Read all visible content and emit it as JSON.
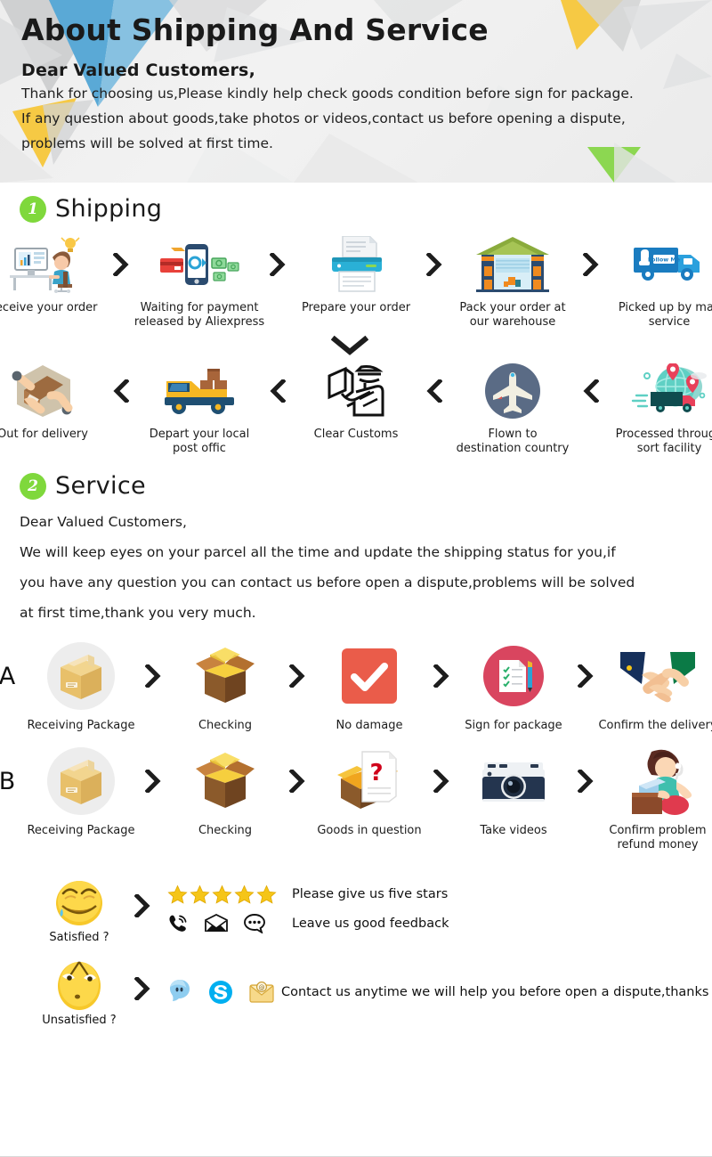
{
  "banner": {
    "title": "About Shipping And Service",
    "subtitle": "Dear Valued Customers,",
    "lines": [
      "Thank for choosing us,Please kindly help check goods condition before sign for package.",
      "If any question about goods,take photos or videos,contact us before opening a dispute,",
      "problems will be solved at first time."
    ]
  },
  "colors": {
    "accent_green": "#7fd83c",
    "banner_bg": "#eeeeee",
    "deco_blue": "#5aa9d6",
    "deco_yellow": "#f6c944",
    "deco_green": "#8cd751",
    "deco_grey": "#c9cacb",
    "star_yellow": "#f5c518",
    "red_check": "#ea5c4a",
    "pink_sign": "#d9455f"
  },
  "shipping": {
    "badge": "1",
    "title": "Shipping",
    "row1": [
      {
        "icon": "desk-person-icon",
        "label": "Receive your order"
      },
      {
        "icon": "phone-payment-icon",
        "label": "Waiting for payment\nreleased by Aliexpress"
      },
      {
        "icon": "printer-icon",
        "label": "Prepare your order"
      },
      {
        "icon": "warehouse-icon",
        "label": "Pack your order at\nour warehouse"
      },
      {
        "icon": "mail-truck-icon",
        "label": "Picked up by mail service"
      }
    ],
    "row1_separator": "chevron-right-icon",
    "turn_icon": "chevron-down-icon",
    "row2": [
      {
        "icon": "hands-package-icon",
        "label": "Out for delivery"
      },
      {
        "icon": "delivery-van-icon",
        "label": "Depart your local\npost offic"
      },
      {
        "icon": "customs-officer-icon",
        "label": "Clear Customs"
      },
      {
        "icon": "airplane-icon",
        "label": "Flown to\ndestination country"
      },
      {
        "icon": "globe-truck-icon",
        "label": "Processed through\nsort facility"
      }
    ],
    "row2_separator": "chevron-left-icon"
  },
  "service": {
    "badge": "2",
    "title": "Service",
    "greeting": "Dear Valued Customers,",
    "lines": [
      "We will keep eyes on your parcel all the time and update the shipping status for you,if",
      "you have any question you can contact us before open a dispute,problems will be solved",
      "at first time,thank you very much."
    ],
    "flow_a": {
      "letter": "A",
      "steps": [
        {
          "icon": "package-box-icon",
          "label": "Receiving Package"
        },
        {
          "icon": "open-box-icon",
          "label": "Checking"
        },
        {
          "icon": "red-check-icon",
          "label": "No damage"
        },
        {
          "icon": "sign-document-icon",
          "label": "Sign for package"
        },
        {
          "icon": "handshake-icon",
          "label": "Confirm the delivery"
        }
      ]
    },
    "flow_b": {
      "letter": "B",
      "steps": [
        {
          "icon": "package-box-icon",
          "label": "Receiving Package"
        },
        {
          "icon": "open-box-icon",
          "label": "Checking"
        },
        {
          "icon": "question-goods-icon",
          "label": "Goods in question"
        },
        {
          "icon": "camera-icon",
          "label": "Take videos"
        },
        {
          "icon": "support-agent-icon",
          "label": "Confirm problem\nrefund money"
        }
      ]
    },
    "separator": "chevron-right-icon"
  },
  "feedback": {
    "satisfied": {
      "icon": "smiling-face-icon",
      "caption": "Satisfied ?",
      "separator": "chevron-right-icon",
      "lines": [
        {
          "icons": [
            "five-stars-icon"
          ],
          "stars": 5,
          "label": "Please give us five stars"
        },
        {
          "icons": [
            "phone-icon",
            "envelope-icon",
            "chat-bubble-icon"
          ],
          "label": "Leave us good feedback"
        }
      ]
    },
    "unsatisfied": {
      "icon": "worried-face-icon",
      "caption": "Unsatisfied ?",
      "separator": "chevron-right-icon",
      "icons": [
        "messenger-icon",
        "skype-icon",
        "email-icon"
      ],
      "label": "Contact us anytime we will help you before open a dispute,thanks"
    }
  }
}
